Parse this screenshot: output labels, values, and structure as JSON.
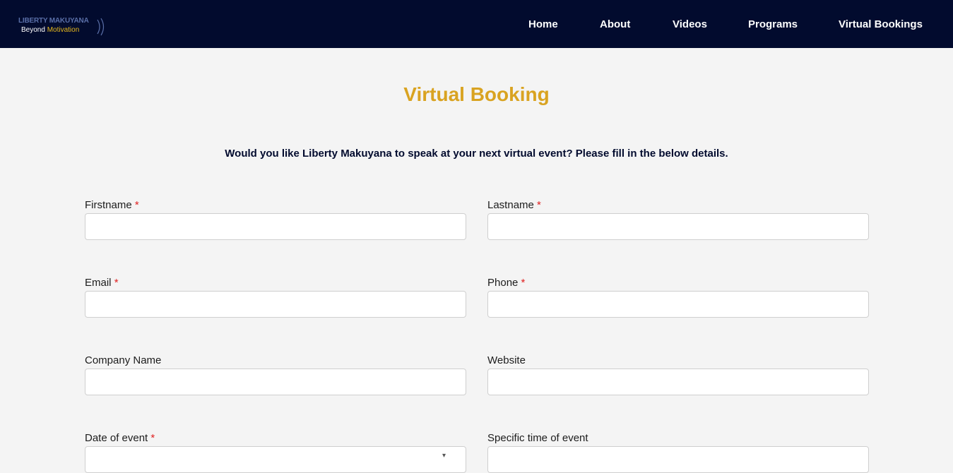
{
  "header": {
    "logo": {
      "line1": "LIBERTY MAKUYANA",
      "line2_a": "Beyond ",
      "line2_b": "Motivation"
    },
    "nav": {
      "home": "Home",
      "about": "About",
      "videos": "Videos",
      "programs": "Programs",
      "virtual_bookings": "Virtual Bookings"
    }
  },
  "main": {
    "title": "Virtual Booking",
    "intro": "Would you like Liberty Makuyana to speak at your next virtual event? Please fill in the below details.",
    "required_marker": "*",
    "fields": {
      "firstname": {
        "label": "Firstname",
        "value": "",
        "required": true
      },
      "lastname": {
        "label": "Lastname",
        "value": "",
        "required": true
      },
      "email": {
        "label": "Email",
        "value": "",
        "required": true
      },
      "phone": {
        "label": "Phone",
        "value": "",
        "required": true
      },
      "company": {
        "label": "Company Name",
        "value": "",
        "required": false
      },
      "website": {
        "label": "Website",
        "value": "",
        "required": false
      },
      "date": {
        "label": "Date of event",
        "value": "",
        "required": true
      },
      "time": {
        "label": "Specific time of event",
        "value": "",
        "required": false
      }
    }
  },
  "colors": {
    "nav_background": "#020b2e",
    "title_gold": "#d9a321",
    "required_red": "#e02020",
    "page_background": "#f4f4f4"
  }
}
